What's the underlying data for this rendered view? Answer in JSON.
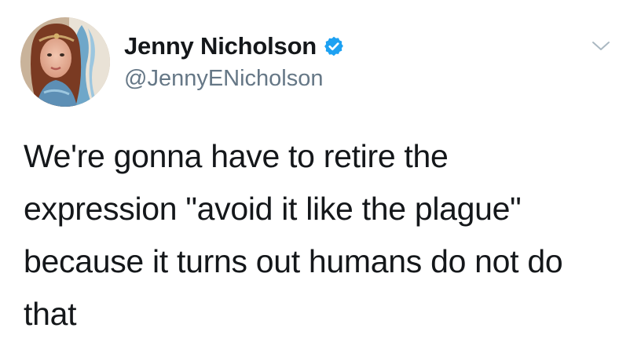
{
  "author": {
    "display_name": "Jenny Nicholson",
    "handle": "@JennyENicholson",
    "verified": true,
    "verified_color": "#1da1f2"
  },
  "tweet": {
    "lines": [
      "We're gonna have to retire the",
      "expression \"avoid it like the plague\"",
      "because it turns out humans do not do",
      "that"
    ]
  },
  "icons": {
    "verified": "verified-badge-icon",
    "menu": "chevron-down-icon"
  },
  "colors": {
    "name": "#14171a",
    "handle": "#657786",
    "caret": "#aab8c2"
  }
}
